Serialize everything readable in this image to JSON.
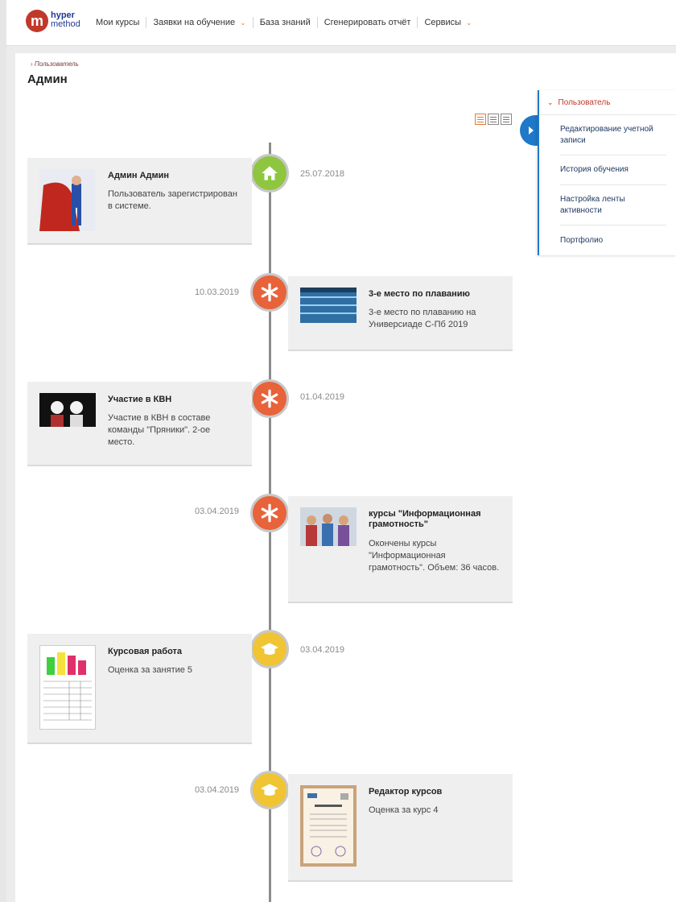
{
  "header": {
    "logo": {
      "line1": "hyper",
      "line2": "method"
    },
    "nav": [
      {
        "label": "Мои курсы",
        "has_dropdown": false
      },
      {
        "label": "Заявки на обучение",
        "has_dropdown": true
      },
      {
        "label": "База знаний",
        "has_dropdown": false
      },
      {
        "label": "Сгенерировать отчёт",
        "has_dropdown": false
      },
      {
        "label": "Сервисы",
        "has_dropdown": true
      }
    ]
  },
  "page": {
    "breadcrumb": "Пользователь",
    "title": "Админ"
  },
  "view_icons": [
    "timeline-view-icon",
    "list-view-icon",
    "table-view-icon"
  ],
  "timeline": [
    {
      "side": "left",
      "icon": "home-icon",
      "color": "#8ec63f",
      "date": "25.07.2018",
      "title": "Админ Админ",
      "text": "Пользователь зарегистрирован в системе.",
      "thumb": "superhero-photo"
    },
    {
      "side": "right",
      "icon": "asterisk-icon",
      "color": "#e8623a",
      "date": "10.03.2019",
      "title": "3-е место по плаванию",
      "text": "3-е место по плаванию на Универсиаде С-Пб 2019",
      "thumb": "swimming-pool-photo"
    },
    {
      "side": "left",
      "icon": "asterisk-icon",
      "color": "#e8623a",
      "date": "01.04.2019",
      "title": "Участие в КВН",
      "text": "Участие в КВН в составе команды \"Пряники\". 2-ое место.",
      "thumb": "mimes-photo"
    },
    {
      "side": "right",
      "icon": "asterisk-icon",
      "color": "#e8623a",
      "date": "03.04.2019",
      "title": "курсы \"Информационная грамотность\"",
      "text": "Окончены курсы \"Информационная грамотность\". Объем: 36 часов.",
      "thumb": "students-photo"
    },
    {
      "side": "left",
      "icon": "graduation-cap-icon",
      "color": "#f0c433",
      "date": "03.04.2019",
      "title": "Курсовая работа",
      "text": "Оценка за занятие 5",
      "thumb": "report-chart-document"
    },
    {
      "side": "right",
      "icon": "graduation-cap-icon",
      "color": "#f0c433",
      "date": "03.04.2019",
      "title": "Редактор курсов",
      "text": "Оценка за курс 4",
      "thumb": "certificate-document"
    }
  ],
  "side_panel": {
    "header": "Пользователь",
    "items": [
      "Редактирование учетной записи",
      "История обучения",
      "Настройка ленты активности",
      "Портфолио"
    ]
  }
}
